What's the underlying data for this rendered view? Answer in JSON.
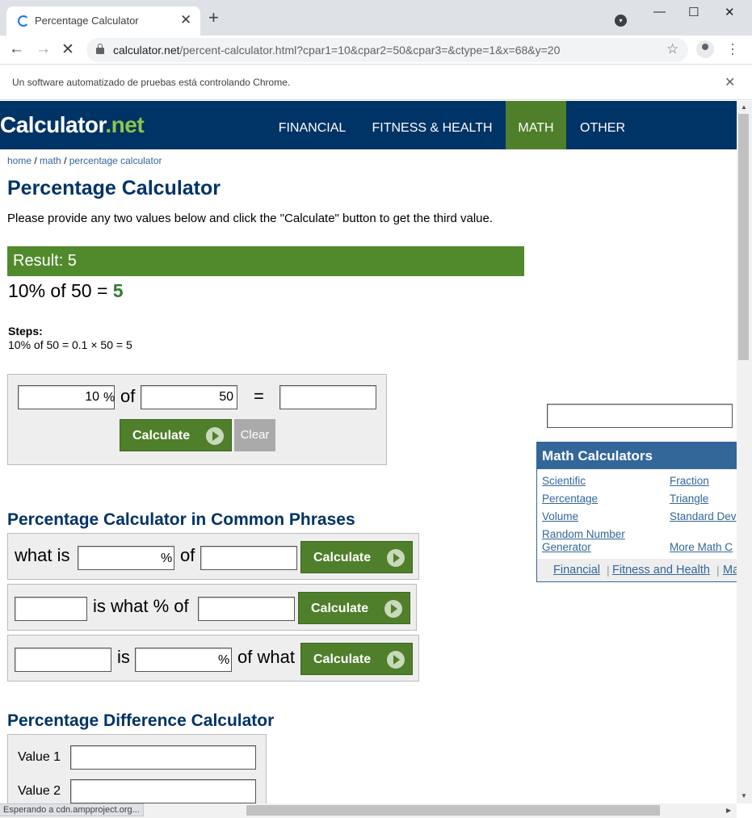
{
  "browser": {
    "tab_title": "Percentage Calculator",
    "new_tab": "+",
    "url_host": "calculator.net",
    "url_path": "/percent-calculator.html?cpar1=10&cpar2=50&cpar3=&ctype=1&x=68&y=20",
    "infobar_message": "Un software automatizado de pruebas está controlando Chrome.",
    "status": "Esperando a cdn.ampproject.org..."
  },
  "site": {
    "logo_main": "Calculator",
    "logo_dot_net": ".net",
    "nav": [
      "FINANCIAL",
      "FITNESS & HEALTH",
      "MATH",
      "OTHER"
    ],
    "breadcrumb": [
      "home",
      "math",
      "percentage calculator"
    ]
  },
  "main": {
    "title": "Percentage Calculator",
    "intro": "Please provide any two values below and click the \"Calculate\" button to get the third value.",
    "result_label": "Result: 5",
    "equation_lhs": "10% of 50 = ",
    "equation_answer": "5",
    "steps_heading": "Steps:",
    "steps_value": "10% of 50 = 0.1 × 50 = 5",
    "calc": {
      "input1": "10",
      "pct": "%",
      "of": "of",
      "input2": "50",
      "equals": "=",
      "input3": "",
      "calculate_label": "Calculate",
      "clear_label": "Clear"
    }
  },
  "phrases": {
    "title": "Percentage Calculator in Common Phrases",
    "row1_a": "what is",
    "row1_pct": "%",
    "row1_b": "of",
    "row2_a": "is what % of",
    "row3_a": "is",
    "row3_pct": "%",
    "row3_b": "of what",
    "calculate_label": "Calculate"
  },
  "difference": {
    "title": "Percentage Difference Calculator",
    "value1_label": "Value 1",
    "value2_label": "Value 2"
  },
  "sidebar": {
    "header": "Math Calculators",
    "links": [
      "Scientific",
      "Fraction",
      "Percentage",
      "Triangle",
      "Volume",
      "Standard Dev",
      "Random Number",
      "Generator",
      "More Math C"
    ],
    "footer": [
      "Financial",
      "Fitness and Health",
      "Ma"
    ]
  }
}
